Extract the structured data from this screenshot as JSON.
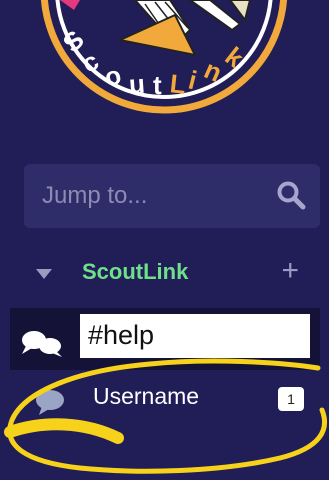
{
  "logo": {
    "text_start": "Scout",
    "text_end": "Link",
    "accent_color": "#f2a93b",
    "ring_color": "#ffffff"
  },
  "search": {
    "placeholder": "Jump to...",
    "icon": "search-icon"
  },
  "workspace": {
    "name": "ScoutLink",
    "name_color": "#6fe08a",
    "add_glyph": "+",
    "icon": "caret-down-icon"
  },
  "channels": [
    {
      "label": "#help",
      "icon": "chat-bubbles-icon"
    }
  ],
  "direct_messages": [
    {
      "name": "Username",
      "badge": "1",
      "icon": "speech-bubble-icon"
    }
  ],
  "annotation": {
    "color": "#f7d21a"
  }
}
